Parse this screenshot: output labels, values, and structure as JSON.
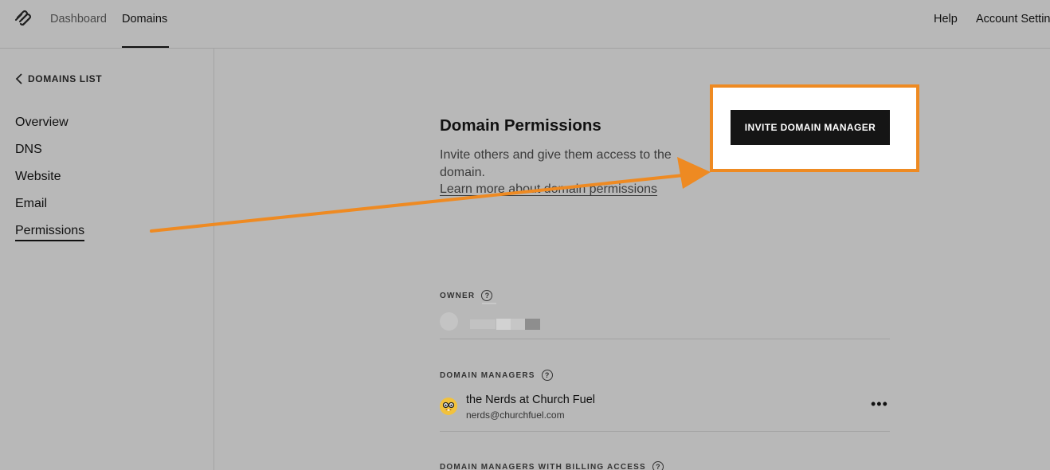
{
  "header": {
    "logo": "squarespace-logo-icon",
    "nav": [
      {
        "label": "Dashboard"
      },
      {
        "label": "Domains"
      }
    ],
    "right": {
      "help": "Help",
      "account": "Account Settings"
    }
  },
  "sidebar": {
    "back_label": "DOMAINS LIST",
    "items": [
      {
        "label": "Overview"
      },
      {
        "label": "DNS"
      },
      {
        "label": "Website"
      },
      {
        "label": "Email"
      },
      {
        "label": "Permissions"
      }
    ],
    "active": "Permissions"
  },
  "main": {
    "title": "Domain Permissions",
    "description": "Invite others and give them access to the domain.",
    "learn_more": "Learn more about domain permissions",
    "invite_button": "INVITE DOMAIN MANAGER",
    "owner": {
      "label": "OWNER"
    },
    "managers": {
      "label": "DOMAIN MANAGERS",
      "items": [
        {
          "name": "the Nerds at Church Fuel",
          "email": "nerds@churchfuel.com",
          "avatar_icon": "nerd-face-emoji-icon"
        }
      ]
    },
    "billing": {
      "label": "DOMAIN MANAGERS WITH BILLING ACCESS"
    }
  },
  "colors": {
    "annotation": "#ee8a22",
    "overlay": "#b8b8b8",
    "button": "#151515"
  }
}
